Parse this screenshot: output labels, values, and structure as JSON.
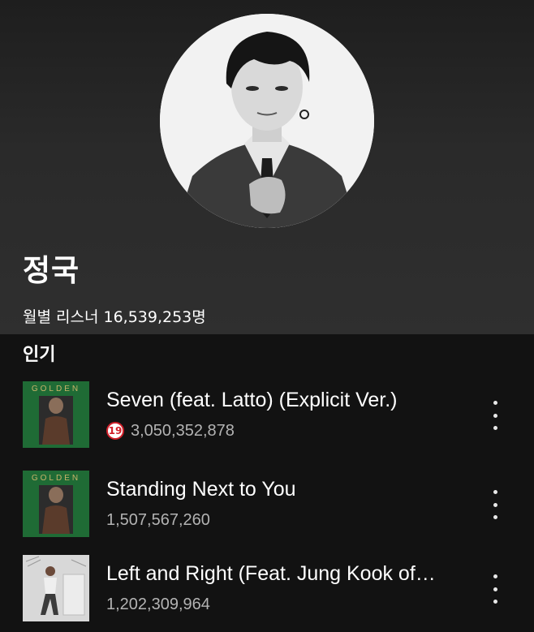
{
  "artist": {
    "name": "정국",
    "monthly_listeners_label": "월별 리스너 16,539,253명"
  },
  "popular": {
    "section_title": "인기",
    "tracks": [
      {
        "title": "Seven (feat. Latto) (Explicit Ver.)",
        "explicit": true,
        "explicit_badge": "19",
        "plays": "3,050,352,878",
        "cover_text": "GOLDEN"
      },
      {
        "title": "Standing Next to You",
        "explicit": false,
        "plays": "1,507,567,260",
        "cover_text": "GOLDEN"
      },
      {
        "title": "Left and Right (Feat. Jung Kook of…",
        "explicit": false,
        "plays": "1,202,309,964"
      }
    ]
  },
  "colors": {
    "background": "#121212",
    "header_gradient_end": "#2f2f2f",
    "text_primary": "#ffffff",
    "text_secondary": "#b3b3b3",
    "explicit_badge": "#d0202a",
    "golden_cover_green": "#1f6b35"
  },
  "icons": {
    "more": "more-vertical-icon",
    "explicit": "explicit-19-icon"
  }
}
